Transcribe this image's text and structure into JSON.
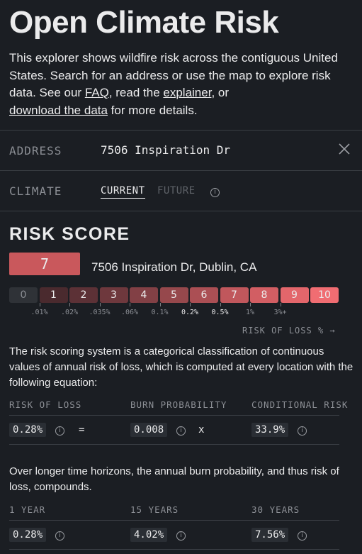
{
  "header": {
    "title": "Open Climate Risk",
    "intro_pre": "This explorer shows wildfire risk across the contiguous United States. Search for an address or use the map to explore risk data. See our ",
    "faq_link": "FAQ",
    "intro_mid": ", read the ",
    "explainer_link": "explainer",
    "intro_or": ", or",
    "download_link": "download the data",
    "intro_post": " for more details."
  },
  "address": {
    "label": "ADDRESS",
    "value": "7506 Inspiration Dr"
  },
  "climate": {
    "label": "CLIMATE",
    "tabs": [
      "CURRENT",
      "FUTURE"
    ],
    "active": "CURRENT"
  },
  "risk_score": {
    "title": "RISK SCORE",
    "score": "7",
    "address_full": "7506 Inspiration Dr, Dublin, CA",
    "scale": [
      {
        "label": "0",
        "color": "#2f3237"
      },
      {
        "label": "1",
        "color": "#4a2a2e"
      },
      {
        "label": "2",
        "color": "#5c3136"
      },
      {
        "label": "3",
        "color": "#6e383d"
      },
      {
        "label": "4",
        "color": "#824045"
      },
      {
        "label": "5",
        "color": "#96484c"
      },
      {
        "label": "6",
        "color": "#ab4f54"
      },
      {
        "label": "7",
        "color": "#c0575c"
      },
      {
        "label": "8",
        "color": "#d25e63"
      },
      {
        "label": "9",
        "color": "#e3666b"
      },
      {
        "label": "10",
        "color": "#f06d72"
      }
    ],
    "thresholds": [
      {
        "label": ".01%",
        "hl": false
      },
      {
        "label": ".02%",
        "hl": false
      },
      {
        "label": ".035%",
        "hl": false
      },
      {
        "label": ".06%",
        "hl": false
      },
      {
        "label": "0.1%",
        "hl": false
      },
      {
        "label": "0.2%",
        "hl": true
      },
      {
        "label": "0.5%",
        "hl": true
      },
      {
        "label": "1%",
        "hl": false
      },
      {
        "label": "3%+",
        "hl": false
      }
    ],
    "axis_label": "RISK OF LOSS % →"
  },
  "equation": {
    "description": "The risk scoring system is a categorical classification of continuous values of annual risk of loss, which is computed at every location with the following equation:",
    "headers": [
      "RISK OF LOSS",
      "BURN PROBABILITY",
      "CONDITIONAL RISK"
    ],
    "values": [
      "0.28%",
      "0.008",
      "33.9%"
    ],
    "operators": [
      "=",
      "x"
    ]
  },
  "horizons": {
    "description": "Over longer time horizons, the annual burn probability, and thus risk of loss, compounds.",
    "headers": [
      "1 YEAR",
      "15 YEARS",
      "30 YEARS"
    ],
    "values": [
      "0.28%",
      "4.02%",
      "7.56%"
    ]
  }
}
